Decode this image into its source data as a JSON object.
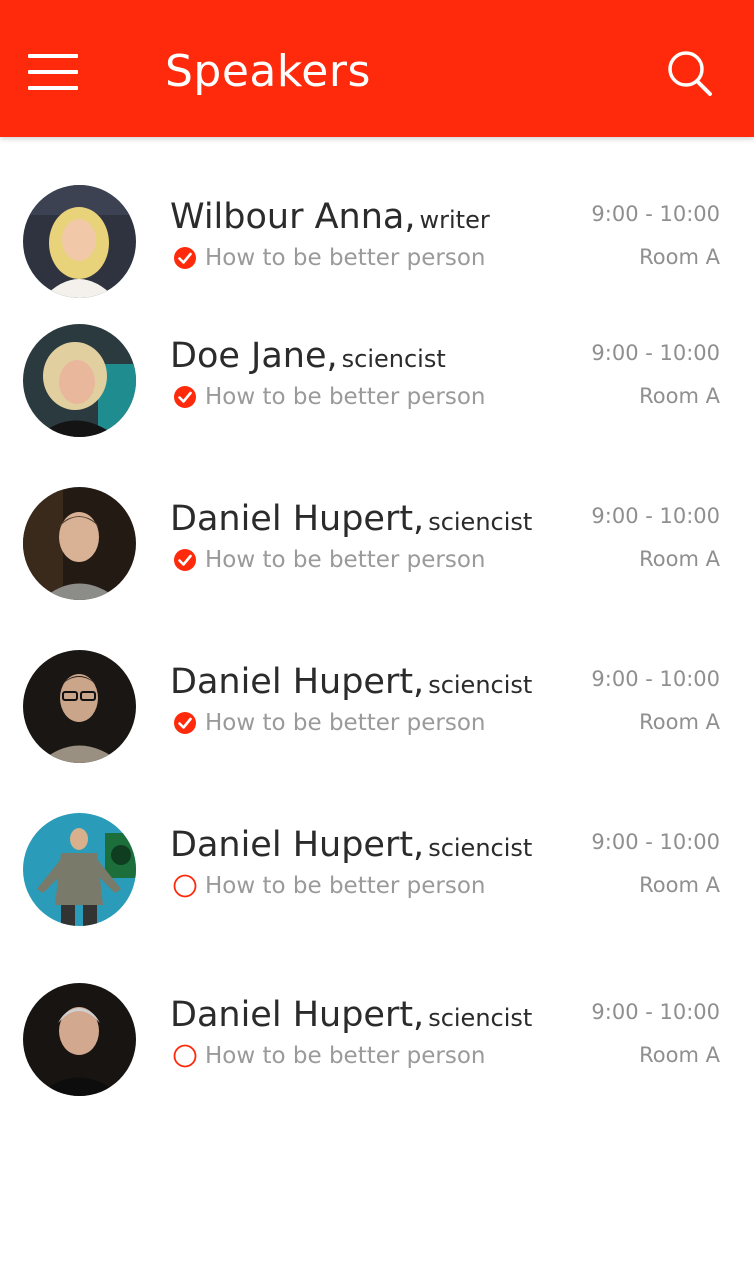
{
  "header": {
    "title": "Speakers",
    "background": "#ff2a0b",
    "menu_icon": "hamburger-menu-icon",
    "search_icon": "search-icon"
  },
  "speakers": [
    {
      "name": "Wilbour Anna,",
      "role": "writer",
      "talk": "How to be better person",
      "time": "9:00 - 10:00",
      "room": "Room A",
      "attending": true
    },
    {
      "name": "Doe Jane,",
      "role": "sciencist",
      "talk": "How to be better person",
      "time": "9:00 - 10:00",
      "room": "Room A",
      "attending": true
    },
    {
      "name": "Daniel Hupert,",
      "role": "sciencist",
      "talk": "How to be better person",
      "time": "9:00 - 10:00",
      "room": "Room A",
      "attending": true
    },
    {
      "name": "Daniel Hupert,",
      "role": "sciencist",
      "talk": "How to be better person",
      "time": "9:00 - 10:00",
      "room": "Room A",
      "attending": true
    },
    {
      "name": "Daniel Hupert,",
      "role": "sciencist",
      "talk": "How to be better person",
      "time": "9:00 - 10:00",
      "room": "Room A",
      "attending": false
    },
    {
      "name": "Daniel Hupert,",
      "role": "sciencist",
      "talk": "How to be better person",
      "time": "9:00 - 10:00",
      "room": "Room A",
      "attending": false
    }
  ],
  "colors": {
    "accent": "#ff2a0b",
    "text_primary": "#2b2b2b",
    "text_secondary": "#9a9a9a"
  }
}
